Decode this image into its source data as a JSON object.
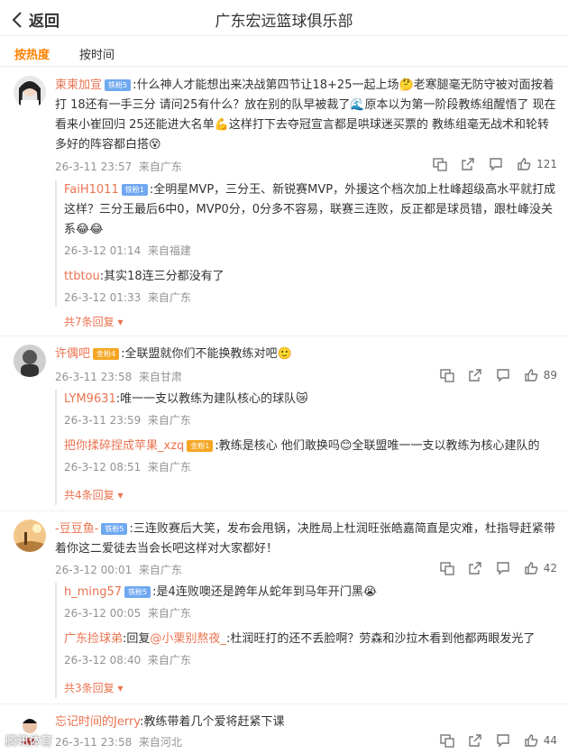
{
  "header": {
    "back_label": "返回",
    "title": "广东宏远篮球俱乐部"
  },
  "sort_tabs": [
    "按热度",
    "按时间"
  ],
  "comments": [
    {
      "user": "柬柬加宣",
      "badge": "铁粉5",
      "text": "什么神人才能想出来决战第四节让18+25一起上场🤔老寒腿毫无防守被对面按着打 18还有一手三分 请问25有什么？放在别的队早被裁了🌊原本以为第一阶段教练组醒悟了 现在看来小崔回归 25还能进大名单💪这样打下去夺冠宣言都是哄球迷买票的 教练组毫无战术和轮转 多好的阵容都白搭😵",
      "time": "26-3-11 23:57",
      "location": "来自广东",
      "likes": "121",
      "replies": [
        {
          "user": "FaiH1011",
          "badge": "铁粉1",
          "text": "全明星MVP，三分王、新锐赛MVP，外援这个档次加上杜峰超级高水平就打成这样？三分王最后6中0，MVP0分，0分多不容易，联赛三连败，反正都是球员错，跟杜峰没关系😂😂",
          "time": "26-3-12 01:14",
          "location": "来自福建"
        },
        {
          "user": "ttbtou",
          "badge": "",
          "text": "其实18连三分都没有了",
          "time": "26-3-12 01:33",
          "location": "来自广东"
        }
      ],
      "more": "共7条回复"
    },
    {
      "user": "许偶吧",
      "badge": "金粉4",
      "text": "全联盟就你们不能换教练对吧🙂",
      "time": "26-3-11 23:58",
      "location": "来自甘肃",
      "likes": "89",
      "replies": [
        {
          "user": "LYM9631",
          "badge": "",
          "text": "唯一一支以教练为建队核心的球队😿",
          "time": "26-3-11 23:59",
          "location": "来自广东"
        },
        {
          "user": "把你揉碎捏成苹果_xzq",
          "badge": "金粉1",
          "text": "教练是核心 他们敢换吗😊全联盟唯一一支以教练为核心建队的",
          "time": "26-3-12 08:51",
          "location": "来自广东"
        }
      ],
      "more": "共4条回复"
    },
    {
      "user": "-豆豆鱼-",
      "badge": "铁粉5",
      "text": "三连败赛后大笑，发布会甩锅，决胜局上杜润旺张皓嘉简直是灾难，杜指导赶紧带着你这二爱徒去当会长吧这样对大家都好！",
      "time": "26-3-12 00:01",
      "location": "来自广东",
      "likes": "42",
      "replies": [
        {
          "user": "h_ming57",
          "badge": "铁粉5",
          "text": "是4连败噢还是跨年从蛇年到马年开门黑😭",
          "time": "26-3-12 00:05",
          "location": "来自广东"
        },
        {
          "user": "广东捡球弟",
          "badge": "",
          "text_prefix": "回复",
          "mention": "@小栗别熬夜_",
          "text": "杜润旺打的还不丢脸啊？劳森和沙拉木看到他都两眼发光了",
          "time": "26-3-12 08:40",
          "location": "来自广东"
        }
      ],
      "more": "共3条回复"
    },
    {
      "user": "忘记时间的Jerry",
      "badge": "",
      "text": "教练带着几个爱将赶紧下课",
      "time": "26-3-11 23:58",
      "location": "来自河北",
      "likes": "44",
      "replies": []
    }
  ],
  "watermark": "腾讯体育"
}
